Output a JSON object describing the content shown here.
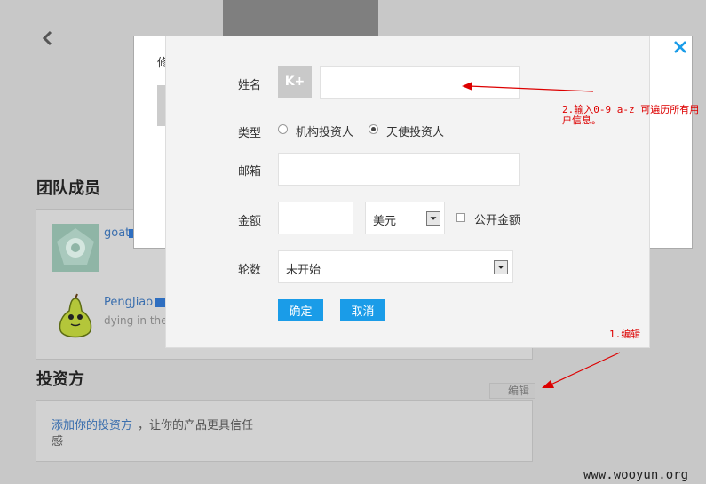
{
  "background": {
    "dialog_title_char": "修",
    "team_section_title": "团队成员",
    "members": [
      {
        "name": "goat"
      },
      {
        "name": "PengJiao",
        "subtitle": "dying in the s"
      }
    ],
    "investor_section_title": "投资方",
    "edit_label": "编辑",
    "add_investor_link": "添加你的投资方",
    "add_investor_text": "，让你的产品更具信任",
    "add_investor_text_wrap": "感"
  },
  "form": {
    "name_label": "姓名",
    "logo_text": "K+",
    "name_value": "",
    "type_label": "类型",
    "type_options": [
      "机构投资人",
      "天使投资人"
    ],
    "type_selected": "天使投资人",
    "email_label": "邮箱",
    "email_value": "",
    "amount_label": "金额",
    "amount_value": "",
    "currency": "美元",
    "public_amount_label": "公开金额",
    "round_label": "轮数",
    "round_value": "未开始",
    "confirm_label": "确定",
    "cancel_label": "取消"
  },
  "annotations": {
    "note_2_line1": "2.输入0-9 a-z 可遍历所有用",
    "note_2_line2": "户信息。",
    "note_1": "1.编辑"
  },
  "watermark": "www.wooyun.org",
  "colors": {
    "accent_blue": "#1a9ce8",
    "annotation_red": "#dd0000",
    "link_blue": "#3b6fae"
  }
}
